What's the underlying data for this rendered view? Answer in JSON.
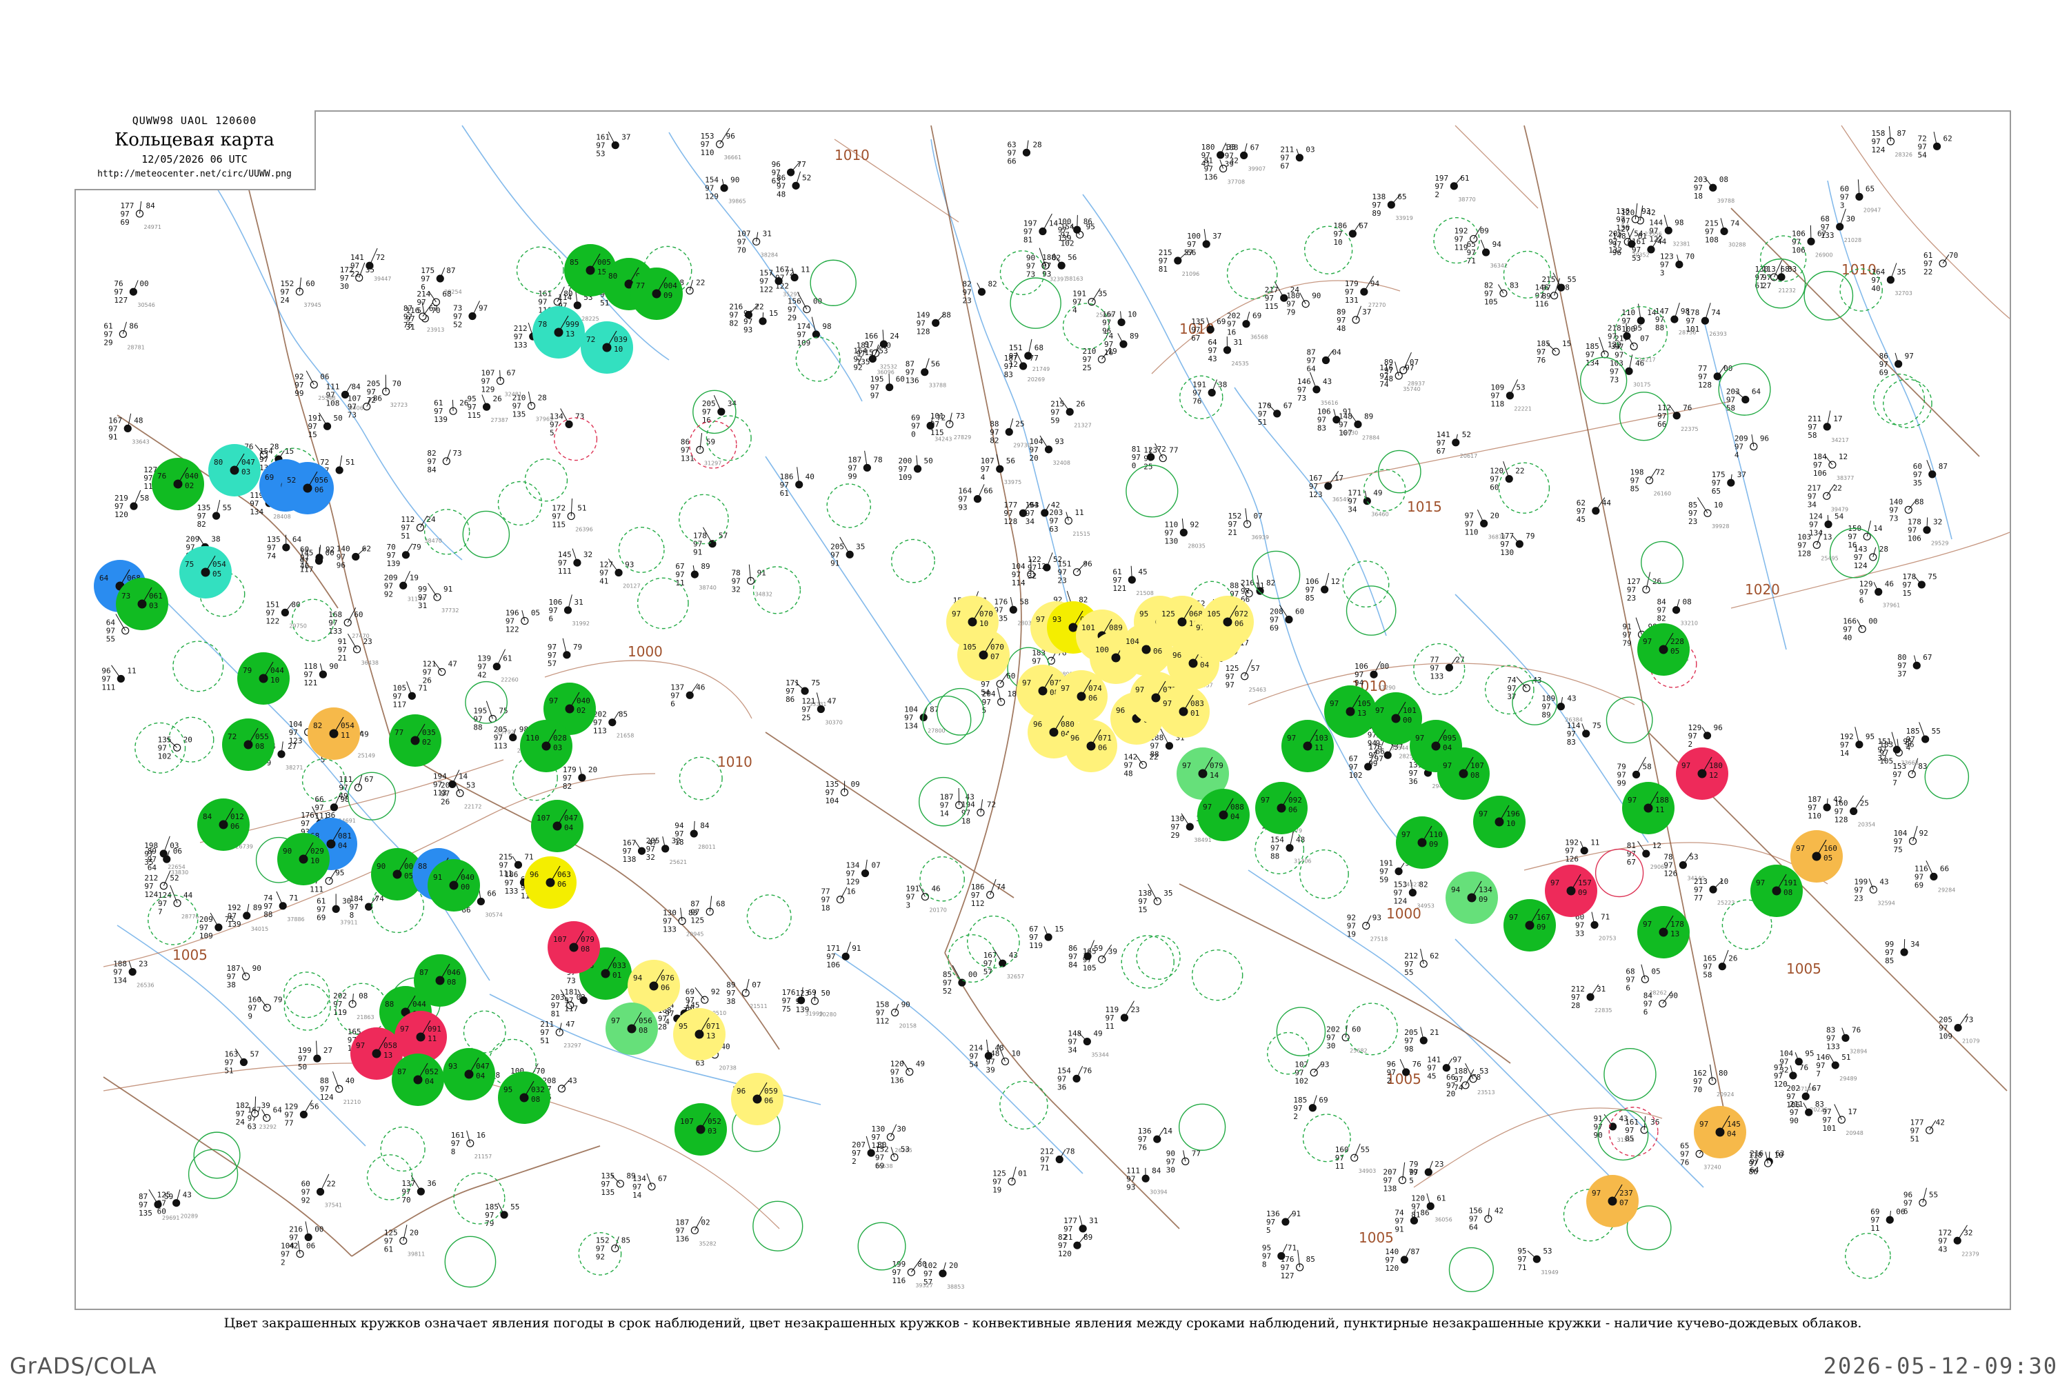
{
  "header": {
    "code": "QUWW98  UAOL  120600",
    "title": "Кольцевая карта",
    "datetime": "12/05/2026 06 UTC",
    "url": "http://meteocenter.net/circ/UUWW.png"
  },
  "legend": {
    "text": "Цвет закрашенных кружков означает явления погоды в срок наблюдений, цвет незакрашенных кружков - конвективные явления между сроками наблюдений, пунктирные незакрашенные кружки - наличие кучево-дождевых облаков."
  },
  "footer": {
    "software": "GrADS/COLA",
    "timestamp": "2026-05-12-09:30"
  },
  "colors": {
    "green": "#11bb22",
    "cyan": "#33e0c0",
    "blue": "#2a8cf0",
    "yellow": "#fff27a",
    "bright_yellow": "#f4ee00",
    "orange": "#f6b94a",
    "red": "#ee2a5a",
    "light_green": "#66e07a",
    "isobar": "#a0522d",
    "river": "#6eaee8",
    "border": "#8b5a3c",
    "ring_green": "#22aa44",
    "ring_red": "#dd3355"
  },
  "isobars": [
    {
      "label": "1005"
    },
    {
      "label": "1000"
    },
    {
      "label": "1010"
    },
    {
      "label": "1005"
    },
    {
      "label": "1010"
    },
    {
      "label": "1010"
    },
    {
      "label": "1015"
    },
    {
      "label": "1020"
    },
    {
      "label": "1010"
    },
    {
      "label": "1005"
    },
    {
      "label": "1000"
    },
    {
      "label": "1010"
    },
    {
      "label": "1005"
    }
  ],
  "stations": [
    {
      "weather": "green",
      "t": "85",
      "d": "15",
      "p": "005"
    },
    {
      "weather": "green",
      "t": "80",
      "d": "12",
      "p": "991"
    },
    {
      "weather": "green",
      "t": "77",
      "d": "09",
      "p": "004"
    },
    {
      "weather": "cyan",
      "t": "78",
      "d": "13",
      "p": "999"
    },
    {
      "weather": "cyan",
      "t": "72",
      "d": "10",
      "p": "039"
    },
    {
      "weather": "blue",
      "t": "69",
      "d": "02",
      "p": "028"
    },
    {
      "weather": "green",
      "t": "76",
      "d": "02",
      "p": "040"
    },
    {
      "weather": "cyan",
      "t": "80",
      "d": "03",
      "p": "047"
    },
    {
      "weather": "blue",
      "t": "52",
      "d": "06",
      "p": "056"
    },
    {
      "weather": "cyan",
      "t": "75",
      "d": "05",
      "p": "054"
    },
    {
      "weather": "blue",
      "t": "64",
      "d": "00",
      "p": "068"
    },
    {
      "weather": "green",
      "t": "73",
      "d": "03",
      "p": "061"
    },
    {
      "weather": "green",
      "t": "79",
      "d": "10",
      "p": "044"
    },
    {
      "weather": "green",
      "t": "72",
      "d": "08",
      "p": "055"
    },
    {
      "weather": "orange",
      "t": "82",
      "d": "11",
      "p": "054"
    },
    {
      "weather": "green",
      "t": "77",
      "d": "02",
      "p": "035"
    },
    {
      "weather": "blue",
      "t": "68",
      "d": "04",
      "p": "081"
    },
    {
      "weather": "green",
      "t": "90",
      "d": "10",
      "p": "029"
    },
    {
      "weather": "green",
      "t": "84",
      "d": "06",
      "p": "012"
    },
    {
      "weather": "green",
      "t": "90",
      "d": "05",
      "p": "004"
    },
    {
      "weather": "blue",
      "t": "88",
      "d": "07",
      "p": "019"
    },
    {
      "weather": "green",
      "t": "91",
      "d": "00",
      "p": "040"
    },
    {
      "weather": "green",
      "t": "87",
      "d": "08",
      "p": "046"
    },
    {
      "weather": "green",
      "t": "88",
      "d": "03",
      "p": "044"
    },
    {
      "weather": "red",
      "t": "97",
      "d": "11",
      "p": "091"
    },
    {
      "weather": "red",
      "t": "97",
      "d": "13",
      "p": "058"
    },
    {
      "weather": "green",
      "t": "87",
      "d": "04",
      "p": "052"
    },
    {
      "weather": "green",
      "t": "93",
      "d": "04",
      "p": "047"
    },
    {
      "weather": "green",
      "t": "95",
      "d": "08",
      "p": "032"
    },
    {
      "weather": "green",
      "t": "96",
      "d": "01",
      "p": "033"
    },
    {
      "weather": "green",
      "t": "97",
      "d": "02",
      "p": "040"
    },
    {
      "weather": "green",
      "t": "110",
      "d": "03",
      "p": "028"
    },
    {
      "weather": "green",
      "t": "107",
      "d": "04",
      "p": "047"
    },
    {
      "weather": "bright_yellow",
      "t": "96",
      "d": "06",
      "p": "063"
    },
    {
      "weather": "red",
      "t": "107",
      "d": "08",
      "p": "079"
    },
    {
      "weather": "yellow",
      "t": "94",
      "d": "06",
      "p": "076"
    },
    {
      "weather": "yellow",
      "t": "95",
      "d": "13",
      "p": "071"
    },
    {
      "weather": "yellow",
      "t": "96",
      "d": "06",
      "p": "059"
    },
    {
      "weather": "green",
      "t": "107",
      "d": "03",
      "p": "052"
    },
    {
      "weather": "light_green",
      "t": "97",
      "d": "08",
      "p": "056"
    },
    {
      "weather": "yellow",
      "t": "97",
      "d": "10",
      "p": "070"
    },
    {
      "weather": "yellow",
      "t": "105",
      "d": "07",
      "p": "070"
    },
    {
      "weather": "yellow",
      "t": "97",
      "d": "08",
      "p": "075"
    },
    {
      "weather": "bright_yellow",
      "t": "93",
      "d": "08",
      "p": "084"
    },
    {
      "weather": "yellow",
      "t": "101",
      "d": "02",
      "p": "089"
    },
    {
      "weather": "yellow",
      "t": "100",
      "d": "08",
      "p": "093"
    },
    {
      "weather": "yellow",
      "t": "104",
      "d": "06",
      "p": "086"
    },
    {
      "weather": "yellow",
      "t": "95",
      "d": "00",
      "p": "079"
    },
    {
      "weather": "yellow",
      "t": "125",
      "d": "10",
      "p": "068"
    },
    {
      "weather": "yellow",
      "t": "96",
      "d": "04",
      "p": "074"
    },
    {
      "weather": "yellow",
      "t": "97",
      "d": "10",
      "p": "076"
    },
    {
      "weather": "yellow",
      "t": "105",
      "d": "06",
      "p": "072"
    },
    {
      "weather": "yellow",
      "t": "97",
      "d": "08",
      "p": "075"
    },
    {
      "weather": "yellow",
      "t": "96",
      "d": "04",
      "p": "080"
    },
    {
      "weather": "yellow",
      "t": "96",
      "d": "06",
      "p": "071"
    },
    {
      "weather": "yellow",
      "t": "97",
      "d": "06",
      "p": "074"
    },
    {
      "weather": "yellow",
      "t": "96",
      "d": "07",
      "p": "068"
    },
    {
      "weather": "yellow",
      "t": "97",
      "d": "09",
      "p": "075"
    },
    {
      "weather": "yellow",
      "t": "97",
      "d": "01",
      "p": "083"
    },
    {
      "weather": "light_green",
      "t": "97",
      "d": "14",
      "p": "079"
    },
    {
      "weather": "green",
      "t": "97",
      "d": "04",
      "p": "088"
    },
    {
      "weather": "green",
      "t": "97",
      "d": "06",
      "p": "092"
    },
    {
      "weather": "green",
      "t": "97",
      "d": "11",
      "p": "103"
    },
    {
      "weather": "green",
      "t": "97",
      "d": "13",
      "p": "105"
    },
    {
      "weather": "green",
      "t": "97",
      "d": "00",
      "p": "101"
    },
    {
      "weather": "green",
      "t": "97",
      "d": "04",
      "p": "095"
    },
    {
      "weather": "green",
      "t": "97",
      "d": "08",
      "p": "107"
    },
    {
      "weather": "green",
      "t": "97",
      "d": "09",
      "p": "110"
    },
    {
      "weather": "light_green",
      "t": "94",
      "d": "09",
      "p": "134"
    },
    {
      "weather": "green",
      "t": "97",
      "d": "09",
      "p": "167"
    },
    {
      "weather": "green",
      "t": "97",
      "d": "10",
      "p": "196"
    },
    {
      "weather": "red",
      "t": "97",
      "d": "09",
      "p": "157"
    },
    {
      "weather": "green",
      "t": "97",
      "d": "11",
      "p": "188"
    },
    {
      "weather": "green",
      "t": "97",
      "d": "13",
      "p": "178"
    },
    {
      "weather": "red",
      "t": "97",
      "d": "12",
      "p": "180"
    },
    {
      "weather": "green",
      "t": "97",
      "d": "05",
      "p": "228"
    },
    {
      "weather": "green",
      "t": "97",
      "d": "08",
      "p": "191"
    },
    {
      "weather": "orange",
      "t": "97",
      "d": "05",
      "p": "160"
    },
    {
      "weather": "orange",
      "t": "97",
      "d": "04",
      "p": "145"
    },
    {
      "weather": "orange",
      "t": "97",
      "d": "07",
      "p": "237"
    }
  ]
}
